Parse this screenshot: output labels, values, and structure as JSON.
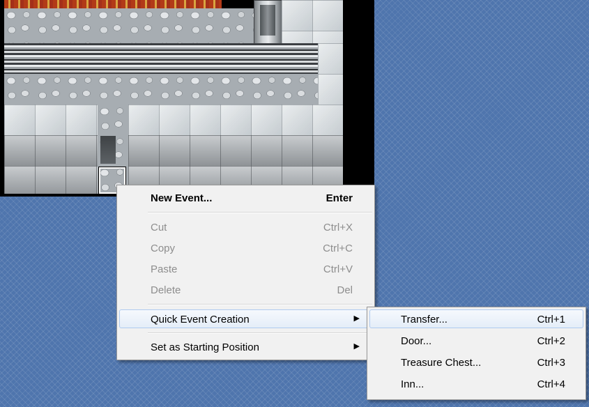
{
  "context_menu": {
    "items": [
      {
        "label": "New Event...",
        "shortcut": "Enter"
      },
      {
        "label": "Cut",
        "shortcut": "Ctrl+X"
      },
      {
        "label": "Copy",
        "shortcut": "Ctrl+C"
      },
      {
        "label": "Paste",
        "shortcut": "Ctrl+V"
      },
      {
        "label": "Delete",
        "shortcut": "Del"
      },
      {
        "label": "Quick Event Creation",
        "submenu_arrow": "▶"
      },
      {
        "label": "Set as Starting Position",
        "submenu_arrow": "▶"
      }
    ]
  },
  "submenu": {
    "items": [
      {
        "label": "Transfer...",
        "shortcut": "Ctrl+1"
      },
      {
        "label": "Door...",
        "shortcut": "Ctrl+2"
      },
      {
        "label": "Treasure Chest...",
        "shortcut": "Ctrl+3"
      },
      {
        "label": "Inn...",
        "shortcut": "Ctrl+4"
      }
    ]
  },
  "icons": {
    "submenu_arrow": "submenu-arrow-icon"
  },
  "colors": {
    "background": "#4f75ad",
    "menu_background": "#f1f1f1",
    "highlight_border": "#aecaf0",
    "disabled_text": "#8d8d8d"
  }
}
